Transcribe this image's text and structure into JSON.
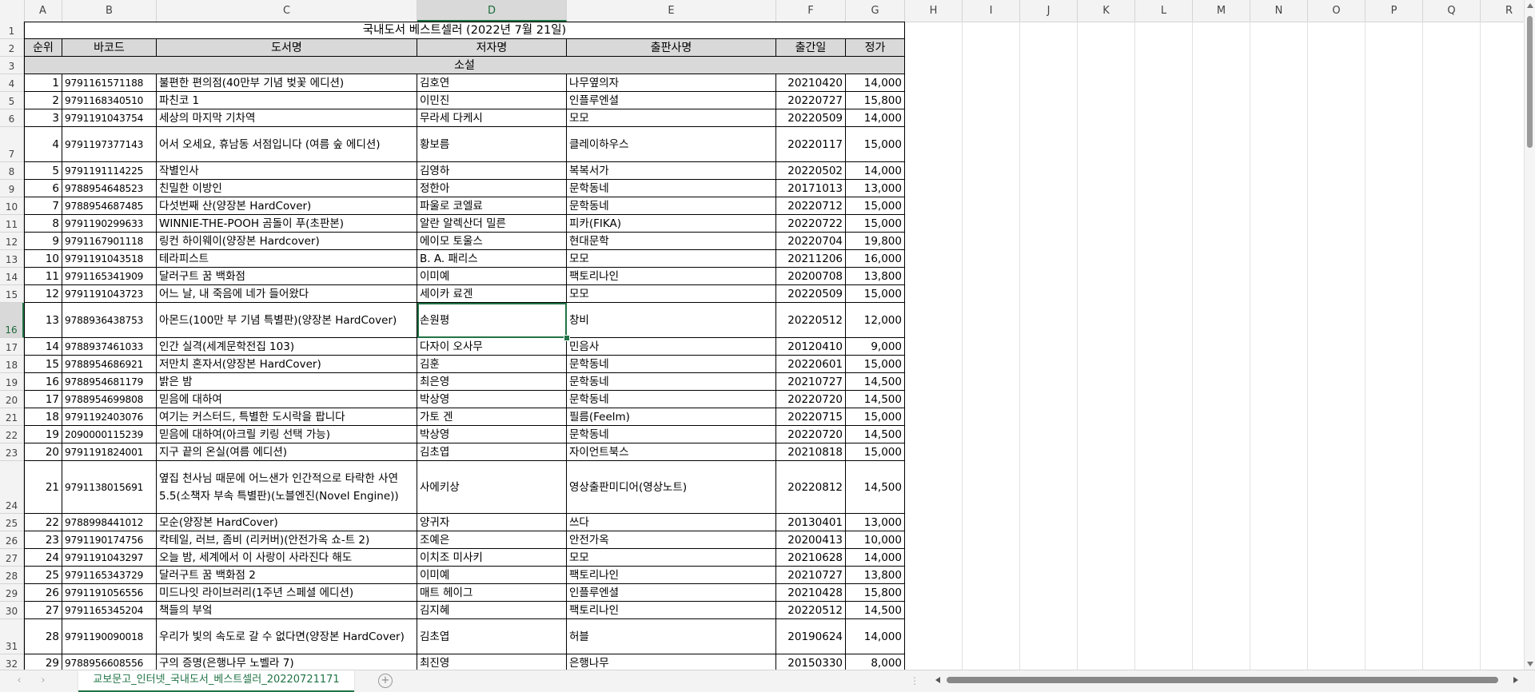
{
  "columns": [
    "A",
    "B",
    "C",
    "D",
    "E",
    "F",
    "G",
    "H",
    "I",
    "J",
    "K",
    "L",
    "M",
    "N",
    "O",
    "P",
    "Q",
    "R"
  ],
  "active_column": "D",
  "active_row": 16,
  "title": "국내도서 베스트셀러 (2022년 7월 21일)",
  "headers": [
    "순위",
    "바코드",
    "도서명",
    "저자명",
    "출판사명",
    "출간일",
    "정가"
  ],
  "category": "소설",
  "rows": [
    {
      "row": 4,
      "rank": "1",
      "barcode": "9791161571188",
      "title": "불편한 편의점(40만부 기념 벚꽃 에디션)",
      "author": "김호연",
      "publisher": "나무옆의자",
      "date": "20210420",
      "price": "14,000"
    },
    {
      "row": 5,
      "rank": "2",
      "barcode": "9791168340510",
      "title": "파친코 1",
      "author": "이민진",
      "publisher": "인플루엔셜",
      "date": "20220727",
      "price": "15,800"
    },
    {
      "row": 6,
      "rank": "3",
      "barcode": "9791191043754",
      "title": "세상의 마지막 기차역",
      "author": "무라세 다케시",
      "publisher": "모모",
      "date": "20220509",
      "price": "14,000"
    },
    {
      "row": 7,
      "rank": "4",
      "barcode": "9791197377143",
      "title": "어서 오세요, 휴남동 서점입니다 (여름 숲 에디션)",
      "author": "황보름",
      "publisher": "클레이하우스",
      "date": "20220117",
      "price": "15,000"
    },
    {
      "row": 8,
      "rank": "5",
      "barcode": "9791191114225",
      "title": "작별인사",
      "author": "김영하",
      "publisher": "복복서가",
      "date": "20220502",
      "price": "14,000"
    },
    {
      "row": 9,
      "rank": "6",
      "barcode": "9788954648523",
      "title": "친밀한 이방인",
      "author": "정한아",
      "publisher": "문학동네",
      "date": "20171013",
      "price": "13,000"
    },
    {
      "row": 10,
      "rank": "7",
      "barcode": "9788954687485",
      "title": "다섯번째 산(양장본 HardCover)",
      "author": "파울로 코엘료",
      "publisher": "문학동네",
      "date": "20220712",
      "price": "15,000"
    },
    {
      "row": 11,
      "rank": "8",
      "barcode": "9791190299633",
      "title": "WINNIE-THE-POOH 곰돌이 푸(초판본)",
      "author": "알란 알렉산더 밀른",
      "publisher": "피카(FIKA)",
      "date": "20220722",
      "price": "15,000"
    },
    {
      "row": 12,
      "rank": "9",
      "barcode": "9791167901118",
      "title": "링컨 하이웨이(양장본 Hardcover)",
      "author": "에이모 토울스",
      "publisher": "현대문학",
      "date": "20220704",
      "price": "19,800"
    },
    {
      "row": 13,
      "rank": "10",
      "barcode": "9791191043518",
      "title": "테라피스트",
      "author": "B. A. 패리스",
      "publisher": "모모",
      "date": "20211206",
      "price": "16,000"
    },
    {
      "row": 14,
      "rank": "11",
      "barcode": "9791165341909",
      "title": "달러구트 꿈 백화점",
      "author": "이미예",
      "publisher": "팩토리나인",
      "date": "20200708",
      "price": "13,800"
    },
    {
      "row": 15,
      "rank": "12",
      "barcode": "9791191043723",
      "title": "어느 날, 내 죽음에 네가 들어왔다",
      "author": "세이카 료겐",
      "publisher": "모모",
      "date": "20220509",
      "price": "15,000"
    },
    {
      "row": 16,
      "rank": "13",
      "barcode": "9788936438753",
      "title": "아몬드(100만 부 기념 특별판)(양장본 HardCover)",
      "author": "손원평",
      "publisher": "창비",
      "date": "20220512",
      "price": "12,000"
    },
    {
      "row": 17,
      "rank": "14",
      "barcode": "9788937461033",
      "title": "인간 실격(세계문학전집 103)",
      "author": "다자이 오사무",
      "publisher": "민음사",
      "date": "20120410",
      "price": "9,000"
    },
    {
      "row": 18,
      "rank": "15",
      "barcode": "9788954686921",
      "title": "저만치 혼자서(양장본 HardCover)",
      "author": "김훈",
      "publisher": "문학동네",
      "date": "20220601",
      "price": "15,000"
    },
    {
      "row": 19,
      "rank": "16",
      "barcode": "9788954681179",
      "title": "밝은 밤",
      "author": "최은영",
      "publisher": "문학동네",
      "date": "20210727",
      "price": "14,500"
    },
    {
      "row": 20,
      "rank": "17",
      "barcode": "9788954699808",
      "title": "믿음에 대하여",
      "author": "박상영",
      "publisher": "문학동네",
      "date": "20220720",
      "price": "14,500"
    },
    {
      "row": 21,
      "rank": "18",
      "barcode": "9791192403076",
      "title": "여기는 커스터드, 특별한 도시락을 팝니다",
      "author": "가토 겐",
      "publisher": "필름(Feelm)",
      "date": "20220715",
      "price": "15,000"
    },
    {
      "row": 22,
      "rank": "19",
      "barcode": "2090000115239",
      "title": "믿음에 대하여(아크릴 키링 선택 가능)",
      "author": "박상영",
      "publisher": "문학동네",
      "date": "20220720",
      "price": "14,500"
    },
    {
      "row": 23,
      "rank": "20",
      "barcode": "9791191824001",
      "title": "지구 끝의 온실(여름 에디션)",
      "author": "김초엽",
      "publisher": "자이언트북스",
      "date": "20210818",
      "price": "15,000"
    },
    {
      "row": 24,
      "rank": "21",
      "barcode": "9791138015691",
      "title": "옆집 천사님 때문에 어느샌가 인간적으로 타락한 사연 5.5(소책자 부속 특별판)(노블엔진(Novel Engine))",
      "author": "사에키상",
      "publisher": "영상출판미디어(영상노트)",
      "date": "20220812",
      "price": "14,500"
    },
    {
      "row": 25,
      "rank": "22",
      "barcode": "9788998441012",
      "title": "모순(양장본 HardCover)",
      "author": "양귀자",
      "publisher": "쓰다",
      "date": "20130401",
      "price": "13,000"
    },
    {
      "row": 26,
      "rank": "23",
      "barcode": "9791190174756",
      "title": "칵테일, 러브, 좀비 (리커버)(안전가옥 쇼-트 2)",
      "author": "조예은",
      "publisher": "안전가옥",
      "date": "20200413",
      "price": "10,000"
    },
    {
      "row": 27,
      "rank": "24",
      "barcode": "9791191043297",
      "title": "오늘 밤, 세계에서 이 사랑이 사라진다 해도",
      "author": "이치조 미사키",
      "publisher": "모모",
      "date": "20210628",
      "price": "14,000"
    },
    {
      "row": 28,
      "rank": "25",
      "barcode": "9791165343729",
      "title": "달러구트 꿈 백화점 2",
      "author": "이미예",
      "publisher": "팩토리나인",
      "date": "20210727",
      "price": "13,800"
    },
    {
      "row": 29,
      "rank": "26",
      "barcode": "9791191056556",
      "title": "미드나잇 라이브러리(1주년 스페셜 에디션)",
      "author": "매트 헤이그",
      "publisher": "인플루엔셜",
      "date": "20210428",
      "price": "15,800"
    },
    {
      "row": 30,
      "rank": "27",
      "barcode": "9791165345204",
      "title": "책들의 부엌",
      "author": "김지혜",
      "publisher": "팩토리나인",
      "date": "20220512",
      "price": "14,500"
    },
    {
      "row": 31,
      "rank": "28",
      "barcode": "9791190090018",
      "title": "우리가 빛의 속도로 갈 수 없다면(양장본 HardCover)",
      "author": "김초엽",
      "publisher": "허블",
      "date": "20190624",
      "price": "14,000"
    },
    {
      "row": 32,
      "rank": "29",
      "barcode": "9788956608556",
      "title": "구의 증명(은행나무 노벨라 7)",
      "author": "최진영",
      "publisher": "은행나무",
      "date": "20150330",
      "price": "8,000"
    }
  ],
  "sheet_tab": "교보문고_인터넷_국내도서_베스트셀러_20220721171",
  "add_sheet_symbol": "+",
  "nav_prev": "‹",
  "nav_next": "›",
  "tab_separator": "⋮",
  "colors": {
    "accent": "#217346",
    "header_fill": "#d9d9d9"
  }
}
